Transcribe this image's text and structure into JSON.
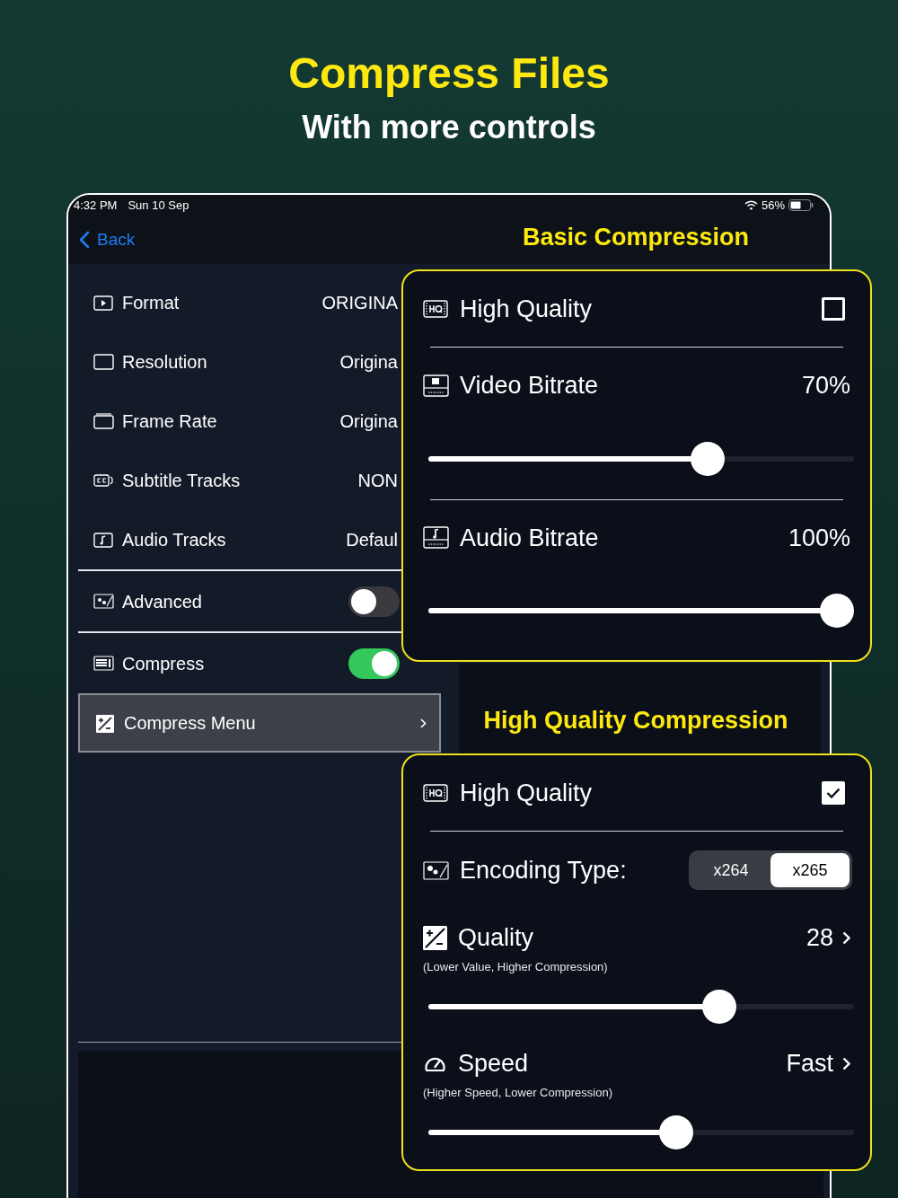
{
  "headline": {
    "title": "Compress Files",
    "subtitle": "With more controls"
  },
  "status_bar": {
    "time": "4:32 PM",
    "date": "Sun 10 Sep",
    "battery": "56%"
  },
  "nav": {
    "back": "Back"
  },
  "settings": [
    {
      "kind": "value",
      "label": "Format",
      "value": "ORIGINA"
    },
    {
      "kind": "value",
      "label": "Resolution",
      "value": "Origina"
    },
    {
      "kind": "value",
      "label": "Frame Rate",
      "value": "Origina"
    },
    {
      "kind": "value",
      "label": "Subtitle Tracks",
      "value": "NON"
    },
    {
      "kind": "value",
      "label": "Audio Tracks",
      "value": "Defaul"
    },
    {
      "kind": "toggle",
      "label": "Advanced",
      "on": false
    },
    {
      "kind": "toggle",
      "label": "Compress",
      "on": true
    },
    {
      "kind": "link",
      "label": "Compress Menu",
      "selected": true
    }
  ],
  "callouts": [
    {
      "caption": "Basic Compression",
      "rows": [
        {
          "kind": "checkbox",
          "label": "High Quality",
          "checked": false
        },
        {
          "kind": "slider",
          "label": "Video Bitrate",
          "reading": "70%",
          "opens_menu": false,
          "level": 0.67
        },
        {
          "kind": "slider",
          "label": "Audio Bitrate",
          "reading": "100%",
          "opens_menu": false,
          "level": 1
        }
      ]
    },
    {
      "caption": "High Quality Compression",
      "rows": [
        {
          "kind": "checkbox",
          "label": "High Quality",
          "checked": true
        },
        {
          "kind": "segmented",
          "label": "Encoding Type:",
          "options": [
            {
              "label": "x264",
              "selected": false
            },
            {
              "label": "x265",
              "selected": true
            }
          ]
        },
        {
          "kind": "slider",
          "label": "Quality",
          "note": "(Lower Value, Higher Compression)",
          "reading": "28",
          "opens_menu": true,
          "level": 0.7
        },
        {
          "kind": "slider",
          "label": "Speed",
          "note": "(Higher Speed, Lower Compression)",
          "reading": "Fast",
          "opens_menu": true,
          "level": 0.59
        }
      ]
    }
  ]
}
